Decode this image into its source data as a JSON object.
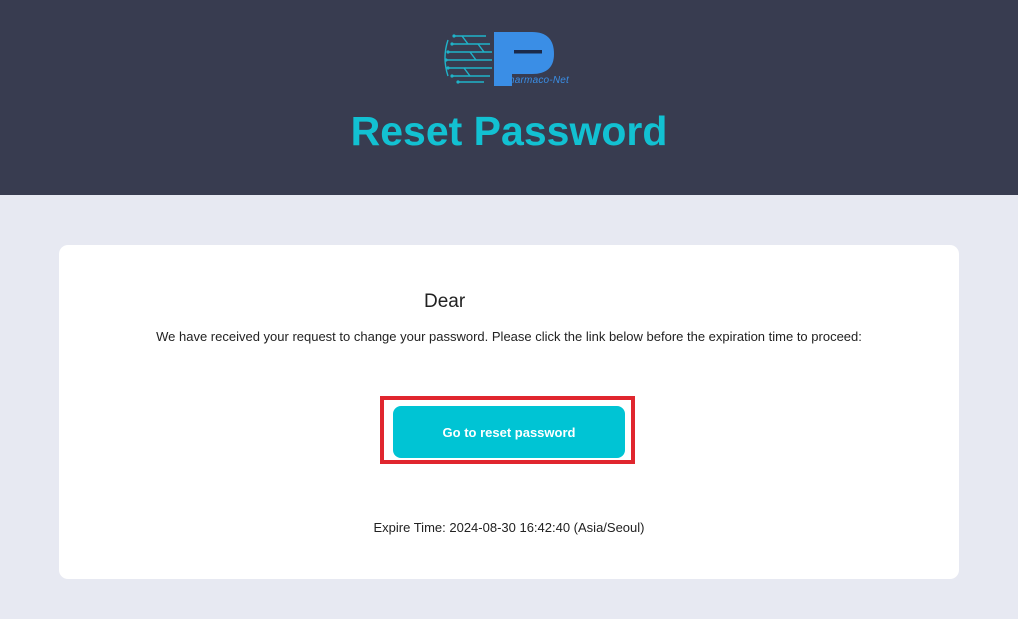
{
  "header": {
    "logo_text": "harmaco-Net",
    "title": "Reset Password"
  },
  "card": {
    "greeting": "Dear",
    "message": "We have received your request to change your password. Please click the link below before the expiration time to proceed:",
    "button_label": "Go to reset password",
    "expire_text": "Expire Time: 2024-08-30 16:42:40 (Asia/Seoul)"
  },
  "colors": {
    "header_bg": "#383c50",
    "page_bg": "#e7e9f2",
    "accent": "#12c1d2",
    "button_bg": "#00c4d4",
    "highlight_border": "#e0262e",
    "logo_blue": "#3a8ee6"
  }
}
